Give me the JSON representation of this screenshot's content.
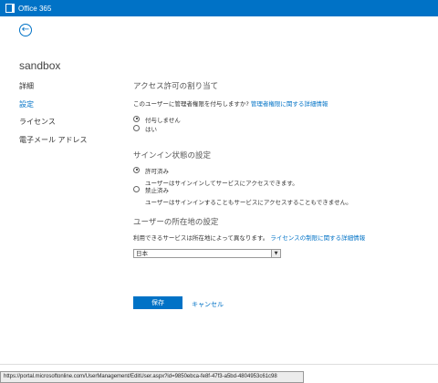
{
  "app": {
    "title": "Office 365",
    "logo_icon": "office-logo-icon"
  },
  "user": {
    "name": "sandbox"
  },
  "nav": {
    "items": [
      {
        "label": "詳細",
        "active": false
      },
      {
        "label": "設定",
        "active": true
      },
      {
        "label": "ライセンス",
        "active": false
      },
      {
        "label": "電子メール アドレス",
        "active": false
      }
    ]
  },
  "access": {
    "heading": "アクセス許可の割り当て",
    "question": "このユーザーに管理者権限を付与しますか?",
    "link": "管理者権限に関する詳細情報",
    "options": [
      {
        "label": "付与しません",
        "selected": true
      },
      {
        "label": "はい",
        "selected": false
      }
    ]
  },
  "signin": {
    "heading": "サインイン状態の設定",
    "options": [
      {
        "label": "許可済み",
        "desc": "ユーザーはサインインしてサービスにアクセスできます。",
        "selected": true
      },
      {
        "label": "禁止済み",
        "desc": "ユーザーはサインインすることもサービスにアクセスすることもできません。",
        "selected": false
      }
    ]
  },
  "location": {
    "heading": "ユーザーの所在地の設定",
    "info": "利用できるサービスは所在地によって異なります。",
    "link": "ライセンスの制限に関する詳細情報",
    "selected": "日本"
  },
  "actions": {
    "save": "保存",
    "cancel": "キャンセル"
  },
  "statusbar": {
    "url": "https://portal.microsoftonline.com/UserManagement/EditUser.aspx?id=9850ebca-fe8f-47f3-a5bd-4804953c61c98"
  },
  "colors": {
    "accent": "#0072c6"
  }
}
